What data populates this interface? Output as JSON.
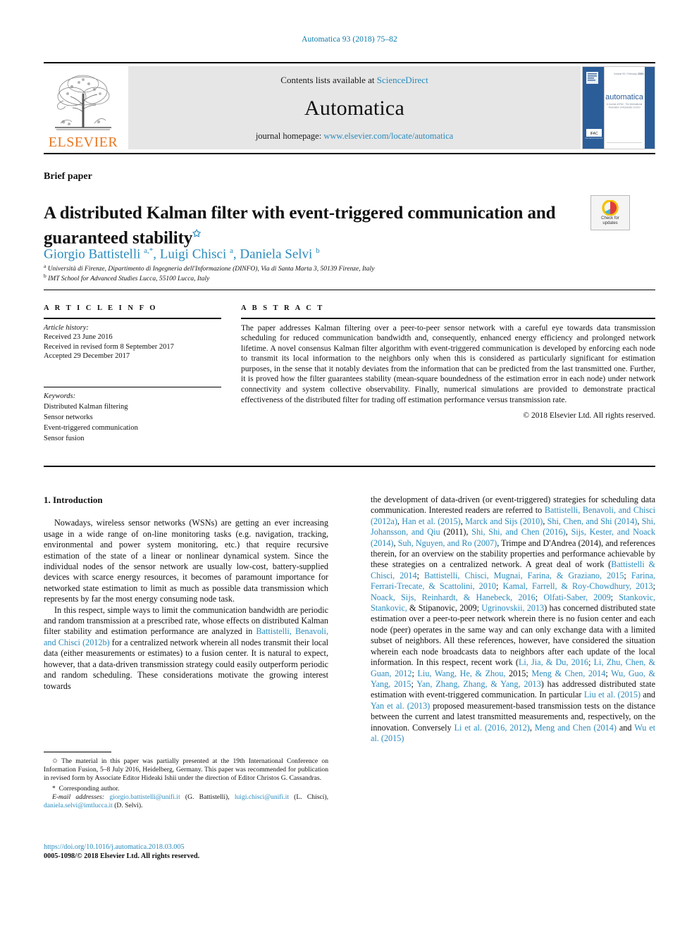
{
  "running_head": "Automatica 93 (2018) 75–82",
  "masthead": {
    "contents_prefix": "Contents lists available at ",
    "contents_link": "ScienceDirect",
    "journal_name": "Automatica",
    "homepage_prefix": "journal homepage: ",
    "homepage_link": "www.elsevier.com/locate/automatica",
    "publisher_logo_text": "ELSEVIER",
    "cover_journal_word": "automatica",
    "cover_tagline": "A Journal of IFAC, The International Federation of Automatic Control",
    "cover_volume_line": "Volume 93 • February 2018    ISSN 0005-1098",
    "cover_ifac_badge": "IFAC"
  },
  "article": {
    "type_label": "Brief paper",
    "title": "A distributed Kalman filter with event-triggered communication and guaranteed stability",
    "title_footnote_marker": "✩",
    "crossmark_line1": "Check for",
    "crossmark_line2": "updates",
    "authors_html": "Giorgio Battistelli <sup>a,*</sup>, Luigi Chisci <sup>a</sup>, Daniela Selvi <sup>b</sup>",
    "affiliation_a": "Università di Firenze, Dipartimento di Ingegneria dell'Informazione (DINFO), Via di Santa Marta 3, 50139 Firenze, Italy",
    "affiliation_b": "IMT School for Advanced Studies Lucca, 55100 Lucca, Italy"
  },
  "article_info": {
    "heading": "A R T I C L E   I N F O",
    "history_label": "Article history:",
    "history": [
      "Received 23 June 2016",
      "Received in revised form 8 September 2017",
      "Accepted 29 December 2017"
    ],
    "keywords_label": "Keywords:",
    "keywords": [
      "Distributed Kalman filtering",
      "Sensor networks",
      "Event-triggered communication",
      "Sensor fusion"
    ]
  },
  "abstract": {
    "heading": "A B S T R A C T",
    "text": "The paper addresses Kalman filtering over a peer-to-peer sensor network with a careful eye towards data transmission scheduling for reduced communication bandwidth and, consequently, enhanced energy efficiency and prolonged network lifetime. A novel consensus Kalman filter algorithm with event-triggered communication is developed by enforcing each node to transmit its local information to the neighbors only when this is considered as particularly significant for estimation purposes, in the sense that it notably deviates from the information that can be predicted from the last transmitted one. Further, it is proved how the filter guarantees stability (mean-square boundedness of the estimation error in each node) under network connectivity and system collective observability. Finally, numerical simulations are provided to demonstrate practical effectiveness of the distributed filter for trading off estimation performance versus transmission rate.",
    "copyright": "© 2018 Elsevier Ltd. All rights reserved."
  },
  "body": {
    "section_number_title": "1. Introduction",
    "left_paragraph_1": "Nowadays, wireless sensor networks (WSNs) are getting an ever increasing usage in a wide range of on-line monitoring tasks (e.g. navigation, tracking, environmental and power system monitoring, etc.) that require recursive estimation of the state of a linear or nonlinear dynamical system. Since the individual nodes of the sensor network are usually low-cost, battery-supplied devices with scarce energy resources, it becomes of paramount importance for networked state estimation to limit as much as possible data transmission which represents by far the most energy consuming node task.",
    "left_paragraph_2": "In this respect, simple ways to limit the communication bandwidth are periodic and random transmission at a prescribed rate, whose effects on distributed Kalman filter stability and estimation performance are analyzed in Battistelli, Benavoli, and Chisci (2012b) for a centralized network wherein all nodes transmit their local data (either measurements or estimates) to a fusion center. It is natural to expect, however, that a data-driven transmission strategy could easily outperform periodic and random scheduling. These considerations motivate the growing interest towards",
    "right_paragraph_1": "the development of data-driven (or event-triggered) strategies for scheduling data communication. Interested readers are referred to Battistelli, Benavoli, and Chisci (2012a), Han et al. (2015), Marck and Sijs (2010), Shi, Chen, and Shi (2014), Shi, Johansson, and Qiu (2011), Shi, Shi, and Chen (2016), Sijs, Kester, and Noack (2014), Suh, Nguyen, and Ro (2007), Trimpe and D'Andrea (2014), and references therein, for an overview on the stability properties and performance achievable by these strategies on a centralized network. A great deal of work (Battistelli & Chisci, 2014; Battistelli, Chisci, Mugnai, Farina, & Graziano, 2015; Farina, Ferrari-Trecate, & Scattolini, 2010; Kamal, Farrell, & Roy-Chowdhury, 2013; Noack, Sijs, Reinhardt, & Hanebeck, 2016; Olfati-Saber, 2009; Stankovic, Stankovic, & Stipanovic, 2009; Ugrinovskii, 2013) has concerned distributed state estimation over a peer-to-peer network wherein there is no fusion center and each node (peer) operates in the same way and can only exchange data with a limited subset of neighbors. All these references, however, have considered the situation wherein each node broadcasts data to neighbors after each update of the local information. In this respect, recent work (Li, Jia, & Du, 2016; Li, Zhu, Chen, & Guan, 2012; Liu, Wang, He, & Zhou, 2015; Meng & Chen, 2014; Wu, Guo, & Yang, 2015; Yan, Zhang, Zhang, & Yang, 2013) has addressed distributed state estimation with event-triggered communication. In particular Liu et al. (2015) and Yan et al. (2013) proposed measurement-based transmission tests on the distance between the current and latest transmitted measurements and, respectively, on the innovation. Conversely Li et al. (2016, 2012), Meng and Chen (2014) and Wu et al. (2015)"
  },
  "footnotes": {
    "star_note": "The material in this paper was partially presented at the 19th International Conference on Information Fusion, 5–8 July 2016, Heidelberg, Germany. This paper was recommended for publication in revised form by Associate Editor Hideaki Ishii under the direction of Editor Christos G. Cassandras.",
    "corresponding": "Corresponding author.",
    "email_label": "E-mail addresses:",
    "emails": [
      {
        "address": "giorgio.battistelli@unifi.it",
        "name": "(G. Battistelli)"
      },
      {
        "address": "luigi.chisci@unifi.it",
        "name": "(L. Chisci)"
      },
      {
        "address": "daniela.selvi@imtlucca.it",
        "name": "(D. Selvi)"
      }
    ]
  },
  "doi_block": {
    "doi": "https://doi.org/10.1016/j.automatica.2018.03.005",
    "issn_line": "0005-1098/© 2018 Elsevier Ltd. All rights reserved."
  },
  "colors": {
    "link_blue": "#2a8bbd",
    "running_head_blue": "#0b7aa8",
    "elsevier_orange": "#E87722",
    "cover_blue": "#2b5d99"
  }
}
